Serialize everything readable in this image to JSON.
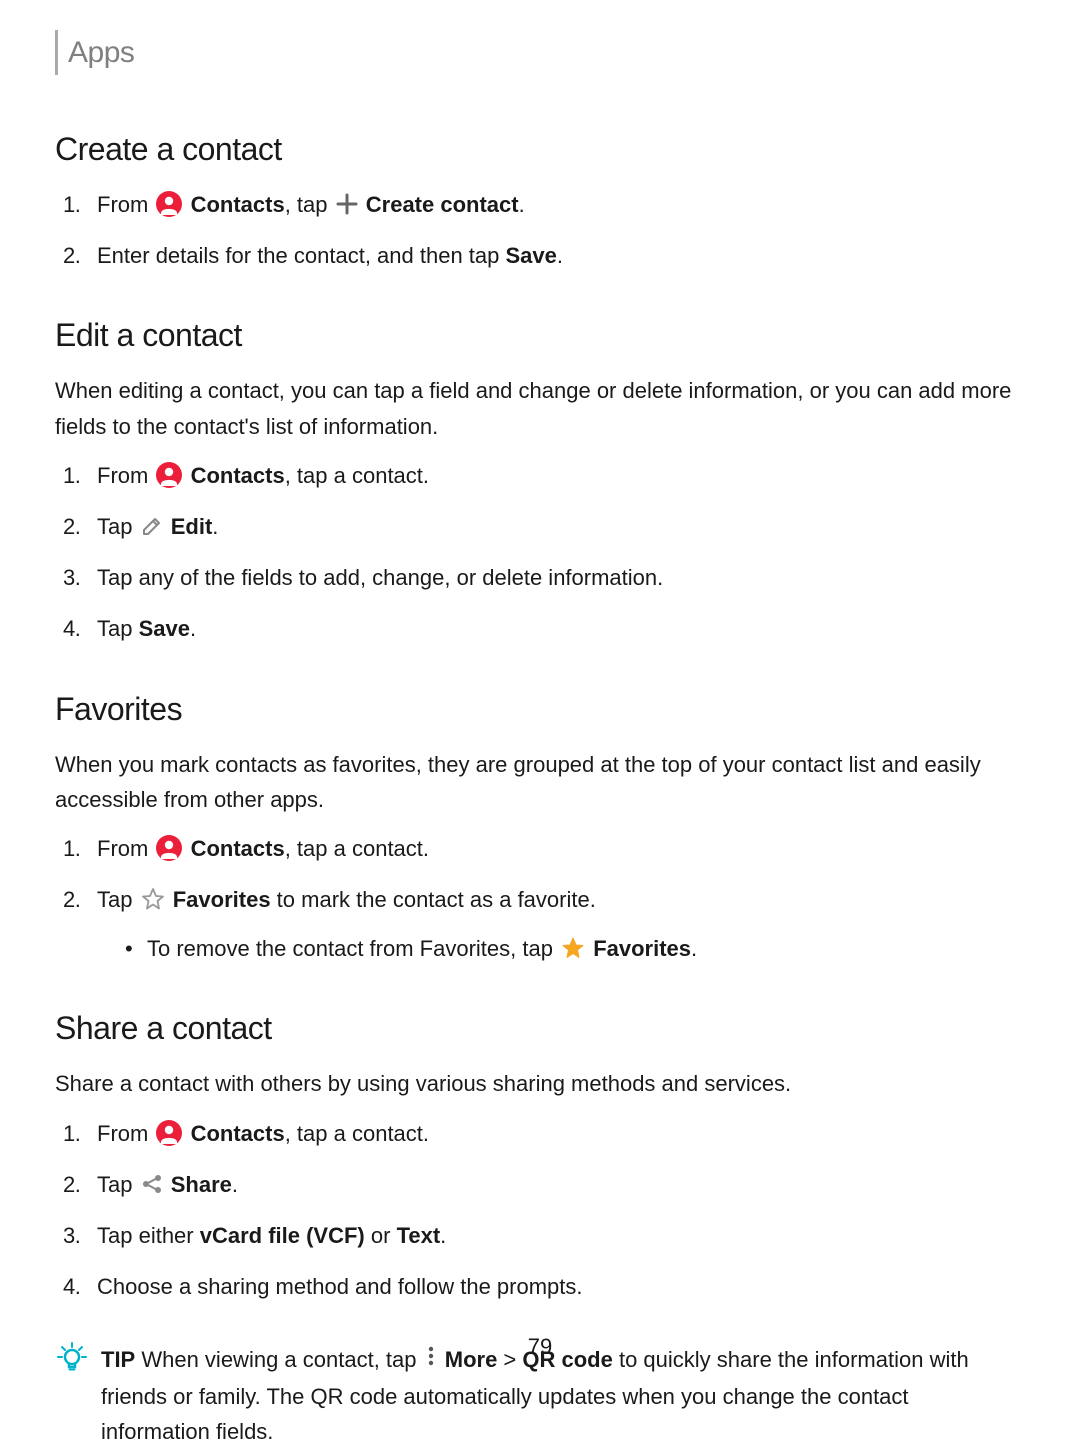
{
  "breadcrumb": "Apps",
  "sections": {
    "create": {
      "heading": "Create a contact",
      "step1_pre": "From",
      "step1_contacts": "Contacts",
      "step1_mid": ", tap",
      "step1_createcontact": "Create contact",
      "step1_end": ".",
      "step2_pre": "Enter details for the contact, and then tap ",
      "step2_save": "Save",
      "step2_end": "."
    },
    "edit": {
      "heading": "Edit a contact",
      "intro": "When editing a contact, you can tap a field and change or delete information, or you can add more fields to the contact's list of information.",
      "step1_pre": "From",
      "step1_contacts": "Contacts",
      "step1_end": ", tap a contact.",
      "step2_pre": "Tap",
      "step2_edit": "Edit",
      "step2_end": ".",
      "step3": "Tap any of the fields to add, change, or delete information.",
      "step4_pre": "Tap ",
      "step4_save": "Save",
      "step4_end": "."
    },
    "favorites": {
      "heading": "Favorites",
      "intro": "When you mark contacts as favorites, they are grouped at the top of your contact list and easily accessible from other apps.",
      "step1_pre": "From",
      "step1_contacts": "Contacts",
      "step1_end": ", tap a contact.",
      "step2_pre": "Tap",
      "step2_fav": "Favorites",
      "step2_end": " to mark the contact as a favorite.",
      "sub_pre": "To remove the contact from Favorites, tap",
      "sub_fav": "Favorites",
      "sub_end": "."
    },
    "share": {
      "heading": "Share a contact",
      "intro": "Share a contact with others by using various sharing methods and services.",
      "step1_pre": "From",
      "step1_contacts": "Contacts",
      "step1_end": ", tap a contact.",
      "step2_pre": "Tap",
      "step2_share": "Share",
      "step2_end": ".",
      "step3_pre": "Tap either ",
      "step3_vcf": "vCard file (VCF)",
      "step3_or": " or ",
      "step3_text": "Text",
      "step3_end": ".",
      "step4": "Choose a sharing method and follow the prompts."
    }
  },
  "tip": {
    "label": "TIP",
    "pre": "  When viewing a contact, tap",
    "more": "More",
    "gt": " > ",
    "qr": "QR code",
    "post": " to quickly share the information with friends or family. The QR code automatically updates when you change the contact information fields."
  },
  "page_number": "79"
}
